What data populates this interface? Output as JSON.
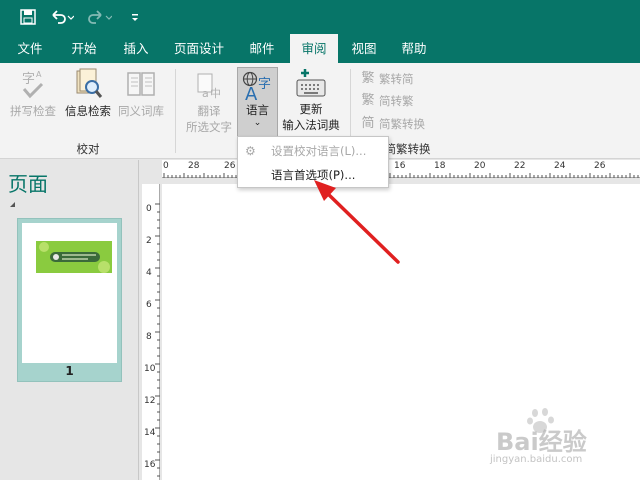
{
  "quick_access": {
    "save_icon": "save-icon",
    "undo_icon": "undo-icon",
    "redo_icon": "redo-icon",
    "customize_icon": "customize-icon"
  },
  "tabs": [
    {
      "label": "文件"
    },
    {
      "label": "开始"
    },
    {
      "label": "插入"
    },
    {
      "label": "页面设计"
    },
    {
      "label": "邮件"
    },
    {
      "label": "审阅"
    },
    {
      "label": "视图"
    },
    {
      "label": "帮助"
    }
  ],
  "active_tab": "审阅",
  "ribbon": {
    "proofing": {
      "spell_check": "拼写检查",
      "research": "信息检索",
      "thesaurus": "同义词库",
      "group_label": "校对"
    },
    "language": {
      "translate_line1": "翻译",
      "translate_line2": "所选文字",
      "language_label": "语言",
      "update_line1": "更新",
      "update_line2": "输入法词典"
    },
    "chinese": {
      "to_simplified": "繁转简",
      "to_traditional": "简转繁",
      "convert": "简繁转换",
      "group_label": "中文简繁转换"
    }
  },
  "language_menu": {
    "items": [
      {
        "label": "设置校对语言(L)...",
        "enabled": false
      },
      {
        "label": "语言首选项(P)...",
        "enabled": true
      }
    ]
  },
  "pages_pane": {
    "title": "页面",
    "page_number": "1"
  },
  "ruler": {
    "top_labels": [
      "0",
      "28",
      "26",
      "16",
      "18",
      "20",
      "22",
      "24",
      "26"
    ],
    "left_labels": [
      "0",
      "2",
      "4",
      "6",
      "8",
      "10",
      "12",
      "14",
      "16"
    ]
  },
  "watermark": {
    "brand": "Bai经验",
    "url": "jingyan.baidu.com"
  },
  "colors": {
    "accent": "#077568",
    "arrow": "#e02020"
  }
}
